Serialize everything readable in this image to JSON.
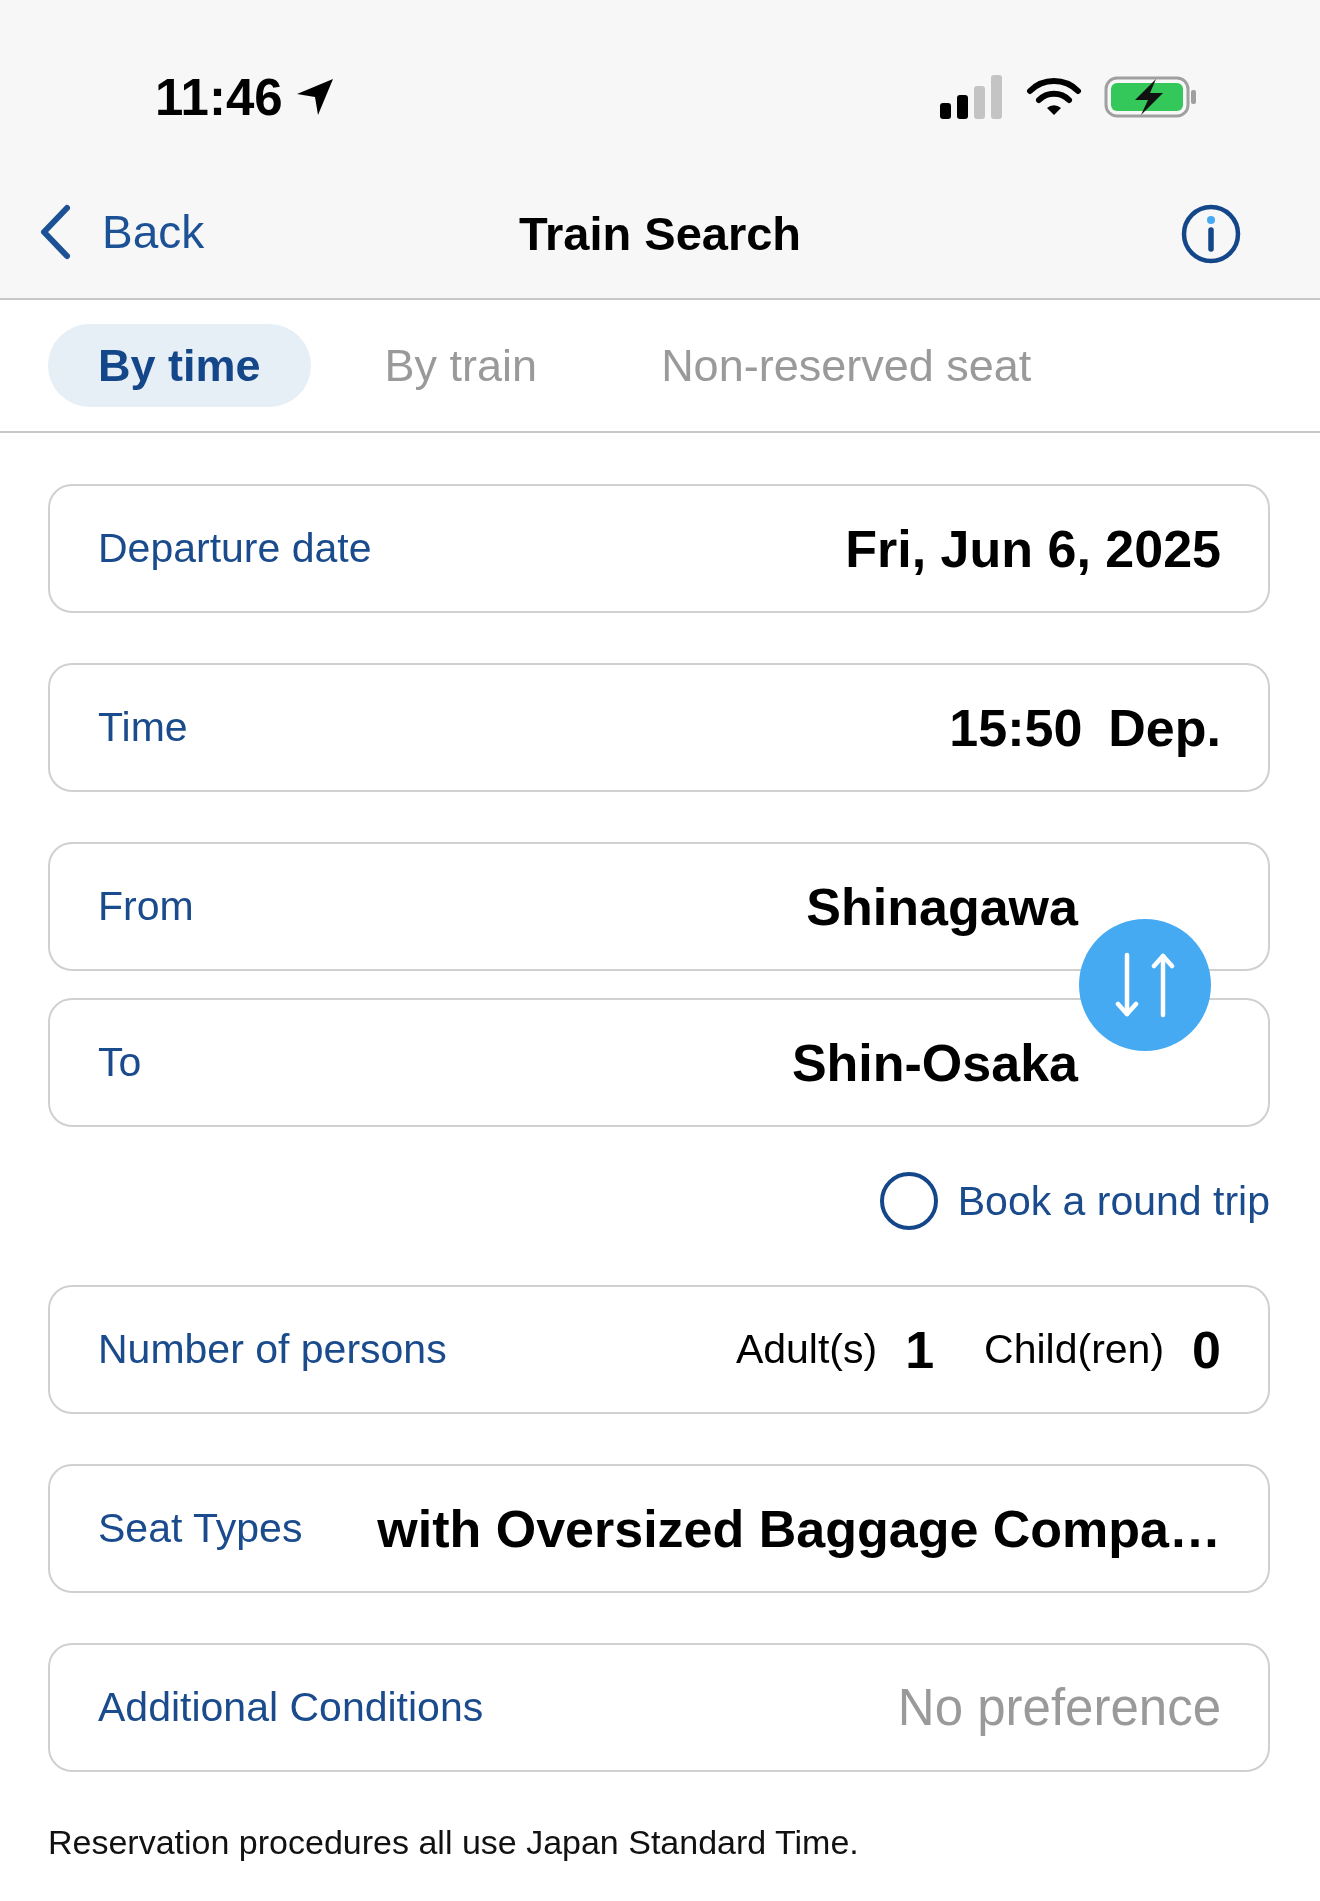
{
  "status_bar": {
    "time": "11:46"
  },
  "nav_bar": {
    "back": "Back",
    "title": "Train Search"
  },
  "tabs": [
    {
      "label": "By time",
      "selected": true
    },
    {
      "label": "By train",
      "selected": false
    },
    {
      "label": "Non-reserved seat",
      "selected": false
    }
  ],
  "date_time": [
    {
      "kind": "date",
      "label": "Departure date",
      "value": "Fri, Jun 6, 2025"
    },
    {
      "kind": "time",
      "label": "Time",
      "value": "15:50",
      "suffix": "Dep."
    }
  ],
  "route": {
    "from": {
      "label": "From",
      "value": "Shinagawa"
    },
    "to": {
      "label": "To",
      "value": "Shin-Osaka"
    }
  },
  "round_trip": {
    "label": "Book a round trip",
    "checked": false
  },
  "persons": {
    "label": "Number of persons",
    "counts": [
      {
        "label": "Adult(s)",
        "value": "1"
      },
      {
        "label": "Child(ren)",
        "value": "0"
      }
    ]
  },
  "conditions": [
    {
      "kind": "value",
      "label": "Seat Types",
      "value": "with Oversized Baggage Compa…"
    },
    {
      "kind": "placeholder",
      "label": "Additional Conditions",
      "placeholder": "No preference"
    }
  ],
  "footer_note": "Reservation procedures all use Japan Standard Time."
}
